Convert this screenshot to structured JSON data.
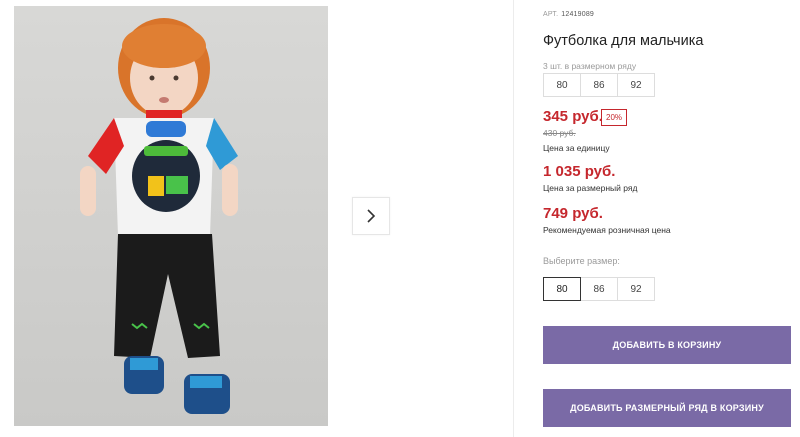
{
  "product": {
    "sku_label": "АРТ.",
    "sku_value": "12419089",
    "title": "Футболка для мальчика",
    "series_note": "3 шт. в размерном ряду",
    "series_sizes": [
      "80",
      "86",
      "92"
    ],
    "price": "345 руб.",
    "discount": "20%",
    "old_price": "430 руб.",
    "unit_note": "Цена за единицу",
    "series_price": "1 035 руб.",
    "series_price_label": "Цена за размерный ряд",
    "retail_price": "749 руб.",
    "retail_price_label": "Рекомендуемая розничная цена",
    "choose_size_label": "Выберите размер:",
    "selectable_sizes": [
      "80",
      "86",
      "92"
    ],
    "selected_size": "80"
  },
  "actions": {
    "add_to_cart": "ДОБАВИТЬ В КОРЗИНУ",
    "add_series_to_cart": "ДОБАВИТЬ РАЗМЕРНЫЙ РЯД В КОРЗИНУ"
  },
  "gallery": {
    "next_icon": "chevron-right-icon"
  },
  "colors": {
    "accent_button": "#7a6aa6",
    "price_red": "#c5272d"
  }
}
